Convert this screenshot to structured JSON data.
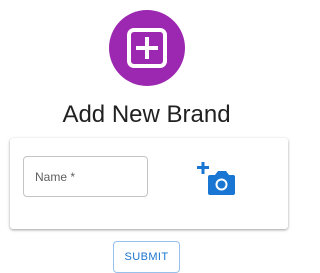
{
  "header": {
    "title": "Add New Brand",
    "avatar_icon": "add-box-icon",
    "avatar_color": "#9c27b0"
  },
  "form": {
    "name_label": "Name *",
    "name_value": "",
    "photo_icon": "add-a-photo-icon",
    "photo_icon_color": "#1976d2"
  },
  "actions": {
    "submit_label": "SUBMIT",
    "submit_color": "#1976d2"
  }
}
